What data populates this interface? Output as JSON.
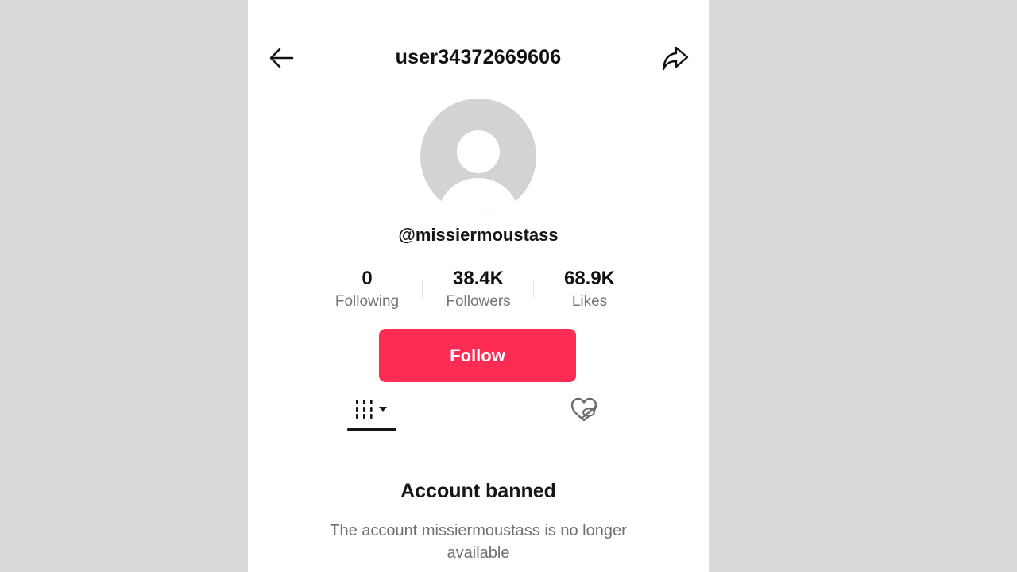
{
  "header": {
    "title": "user34372669606",
    "back_icon": "arrow-left-icon",
    "share_icon": "share-arrow-icon"
  },
  "profile": {
    "avatar_icon": "default-avatar-icon",
    "handle": "@missiermoustass"
  },
  "stats": [
    {
      "value": "0",
      "label": "Following"
    },
    {
      "value": "38.4K",
      "label": "Followers"
    },
    {
      "value": "68.9K",
      "label": "Likes"
    }
  ],
  "actions": {
    "follow_label": "Follow",
    "follow_color": "#fe2c55"
  },
  "tabs": {
    "videos_icon": "video-grid-icon",
    "liked_icon": "hidden-liked-icon"
  },
  "status": {
    "title": "Account banned",
    "description": "The account missiermoustass is no longer available"
  }
}
